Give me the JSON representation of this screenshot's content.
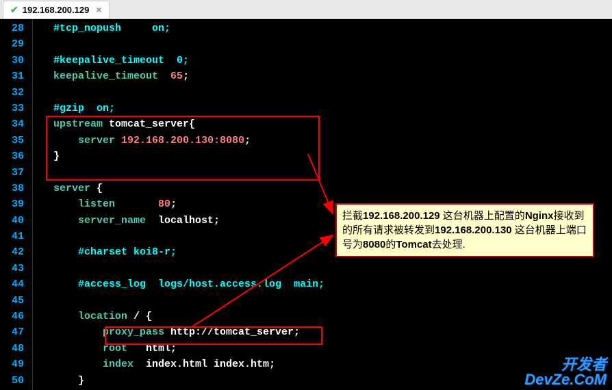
{
  "tab": {
    "title": "192.168.200.129",
    "close": "×"
  },
  "lines": [
    {
      "num": "28",
      "segs": [
        {
          "cls": "comment",
          "txt": "#tcp_nopush     on;"
        }
      ]
    },
    {
      "num": "29",
      "segs": []
    },
    {
      "num": "30",
      "segs": [
        {
          "cls": "comment",
          "txt": "#keepalive_timeout  0;"
        }
      ]
    },
    {
      "num": "31",
      "segs": [
        {
          "cls": "kw",
          "txt": "keepalive_timeout"
        },
        {
          "cls": "plain",
          "txt": "  "
        },
        {
          "cls": "num",
          "txt": "65"
        },
        {
          "cls": "plain",
          "txt": ";"
        }
      ]
    },
    {
      "num": "32",
      "segs": []
    },
    {
      "num": "33",
      "segs": [
        {
          "cls": "comment",
          "txt": "#gzip  on;"
        }
      ]
    },
    {
      "num": "34",
      "segs": [
        {
          "cls": "kw",
          "txt": "upstream"
        },
        {
          "cls": "plain",
          "txt": " tomcat_server{"
        }
      ]
    },
    {
      "num": "35",
      "segs": [
        {
          "cls": "plain",
          "txt": "    "
        },
        {
          "cls": "kw",
          "txt": "server"
        },
        {
          "cls": "plain",
          "txt": " "
        },
        {
          "cls": "num",
          "txt": "192.168.200.130:8080"
        },
        {
          "cls": "plain",
          "txt": ";"
        }
      ]
    },
    {
      "num": "36",
      "segs": [
        {
          "cls": "plain",
          "txt": "}"
        }
      ]
    },
    {
      "num": "37",
      "segs": []
    },
    {
      "num": "38",
      "segs": [
        {
          "cls": "kw",
          "txt": "server"
        },
        {
          "cls": "plain",
          "txt": " {"
        }
      ]
    },
    {
      "num": "39",
      "segs": [
        {
          "cls": "plain",
          "txt": "    "
        },
        {
          "cls": "kw",
          "txt": "listen"
        },
        {
          "cls": "plain",
          "txt": "       "
        },
        {
          "cls": "num",
          "txt": "80"
        },
        {
          "cls": "plain",
          "txt": ";"
        }
      ]
    },
    {
      "num": "40",
      "segs": [
        {
          "cls": "plain",
          "txt": "    "
        },
        {
          "cls": "kw",
          "txt": "server_name"
        },
        {
          "cls": "plain",
          "txt": "  localhost;"
        }
      ]
    },
    {
      "num": "41",
      "segs": []
    },
    {
      "num": "42",
      "segs": [
        {
          "cls": "plain",
          "txt": "    "
        },
        {
          "cls": "comment",
          "txt": "#charset koi8-r;"
        }
      ]
    },
    {
      "num": "43",
      "segs": []
    },
    {
      "num": "44",
      "segs": [
        {
          "cls": "plain",
          "txt": "    "
        },
        {
          "cls": "comment",
          "txt": "#access_log  logs/host.access.log  main;"
        }
      ]
    },
    {
      "num": "45",
      "segs": []
    },
    {
      "num": "46",
      "segs": [
        {
          "cls": "plain",
          "txt": "    "
        },
        {
          "cls": "kw",
          "txt": "location"
        },
        {
          "cls": "plain",
          "txt": " / {"
        }
      ]
    },
    {
      "num": "47",
      "segs": [
        {
          "cls": "plain",
          "txt": "        "
        },
        {
          "cls": "kw",
          "txt": "proxy_pass"
        },
        {
          "cls": "plain",
          "txt": " http://tomcat_server;"
        }
      ]
    },
    {
      "num": "48",
      "segs": [
        {
          "cls": "plain",
          "txt": "        "
        },
        {
          "cls": "kw",
          "txt": "root"
        },
        {
          "cls": "plain",
          "txt": "   html;"
        }
      ]
    },
    {
      "num": "49",
      "segs": [
        {
          "cls": "plain",
          "txt": "        "
        },
        {
          "cls": "kw",
          "txt": "index"
        },
        {
          "cls": "plain",
          "txt": "  index.html index.htm;"
        }
      ]
    },
    {
      "num": "50",
      "segs": [
        {
          "cls": "plain",
          "txt": "    }"
        }
      ]
    }
  ],
  "annotation": {
    "text_parts": [
      {
        "bold": false,
        "txt": "拦截"
      },
      {
        "bold": true,
        "txt": "192.168.200.129"
      },
      {
        "bold": false,
        "txt": " 这台机器上配置的"
      },
      {
        "bold": true,
        "txt": "Nginx"
      },
      {
        "bold": false,
        "txt": "接收到的所有请求被转发到"
      },
      {
        "bold": true,
        "txt": "192.168.200.130"
      },
      {
        "bold": false,
        "txt": " 这台机器上端口号为"
      },
      {
        "bold": true,
        "txt": "8080"
      },
      {
        "bold": false,
        "txt": "的"
      },
      {
        "bold": true,
        "txt": "Tomcat"
      },
      {
        "bold": false,
        "txt": "去处理."
      }
    ]
  },
  "watermark": {
    "line1": "开发者",
    "line2": "DevZe.CoM"
  }
}
